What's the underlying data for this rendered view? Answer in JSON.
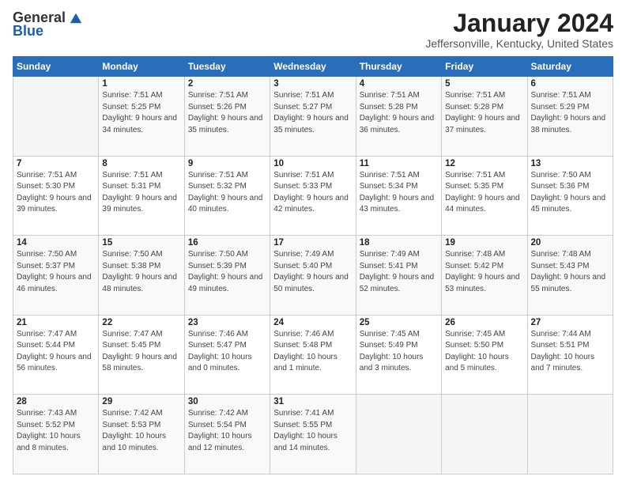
{
  "header": {
    "logo_general": "General",
    "logo_blue": "Blue",
    "month_title": "January 2024",
    "location": "Jeffersonville, Kentucky, United States"
  },
  "calendar": {
    "days_of_week": [
      "Sunday",
      "Monday",
      "Tuesday",
      "Wednesday",
      "Thursday",
      "Friday",
      "Saturday"
    ],
    "weeks": [
      [
        {
          "day": "",
          "sunrise": "",
          "sunset": "",
          "daylight": ""
        },
        {
          "day": "1",
          "sunrise": "Sunrise: 7:51 AM",
          "sunset": "Sunset: 5:25 PM",
          "daylight": "Daylight: 9 hours and 34 minutes."
        },
        {
          "day": "2",
          "sunrise": "Sunrise: 7:51 AM",
          "sunset": "Sunset: 5:26 PM",
          "daylight": "Daylight: 9 hours and 35 minutes."
        },
        {
          "day": "3",
          "sunrise": "Sunrise: 7:51 AM",
          "sunset": "Sunset: 5:27 PM",
          "daylight": "Daylight: 9 hours and 35 minutes."
        },
        {
          "day": "4",
          "sunrise": "Sunrise: 7:51 AM",
          "sunset": "Sunset: 5:28 PM",
          "daylight": "Daylight: 9 hours and 36 minutes."
        },
        {
          "day": "5",
          "sunrise": "Sunrise: 7:51 AM",
          "sunset": "Sunset: 5:28 PM",
          "daylight": "Daylight: 9 hours and 37 minutes."
        },
        {
          "day": "6",
          "sunrise": "Sunrise: 7:51 AM",
          "sunset": "Sunset: 5:29 PM",
          "daylight": "Daylight: 9 hours and 38 minutes."
        }
      ],
      [
        {
          "day": "7",
          "sunrise": "Sunrise: 7:51 AM",
          "sunset": "Sunset: 5:30 PM",
          "daylight": "Daylight: 9 hours and 39 minutes."
        },
        {
          "day": "8",
          "sunrise": "Sunrise: 7:51 AM",
          "sunset": "Sunset: 5:31 PM",
          "daylight": "Daylight: 9 hours and 39 minutes."
        },
        {
          "day": "9",
          "sunrise": "Sunrise: 7:51 AM",
          "sunset": "Sunset: 5:32 PM",
          "daylight": "Daylight: 9 hours and 40 minutes."
        },
        {
          "day": "10",
          "sunrise": "Sunrise: 7:51 AM",
          "sunset": "Sunset: 5:33 PM",
          "daylight": "Daylight: 9 hours and 42 minutes."
        },
        {
          "day": "11",
          "sunrise": "Sunrise: 7:51 AM",
          "sunset": "Sunset: 5:34 PM",
          "daylight": "Daylight: 9 hours and 43 minutes."
        },
        {
          "day": "12",
          "sunrise": "Sunrise: 7:51 AM",
          "sunset": "Sunset: 5:35 PM",
          "daylight": "Daylight: 9 hours and 44 minutes."
        },
        {
          "day": "13",
          "sunrise": "Sunrise: 7:50 AM",
          "sunset": "Sunset: 5:36 PM",
          "daylight": "Daylight: 9 hours and 45 minutes."
        }
      ],
      [
        {
          "day": "14",
          "sunrise": "Sunrise: 7:50 AM",
          "sunset": "Sunset: 5:37 PM",
          "daylight": "Daylight: 9 hours and 46 minutes."
        },
        {
          "day": "15",
          "sunrise": "Sunrise: 7:50 AM",
          "sunset": "Sunset: 5:38 PM",
          "daylight": "Daylight: 9 hours and 48 minutes."
        },
        {
          "day": "16",
          "sunrise": "Sunrise: 7:50 AM",
          "sunset": "Sunset: 5:39 PM",
          "daylight": "Daylight: 9 hours and 49 minutes."
        },
        {
          "day": "17",
          "sunrise": "Sunrise: 7:49 AM",
          "sunset": "Sunset: 5:40 PM",
          "daylight": "Daylight: 9 hours and 50 minutes."
        },
        {
          "day": "18",
          "sunrise": "Sunrise: 7:49 AM",
          "sunset": "Sunset: 5:41 PM",
          "daylight": "Daylight: 9 hours and 52 minutes."
        },
        {
          "day": "19",
          "sunrise": "Sunrise: 7:48 AM",
          "sunset": "Sunset: 5:42 PM",
          "daylight": "Daylight: 9 hours and 53 minutes."
        },
        {
          "day": "20",
          "sunrise": "Sunrise: 7:48 AM",
          "sunset": "Sunset: 5:43 PM",
          "daylight": "Daylight: 9 hours and 55 minutes."
        }
      ],
      [
        {
          "day": "21",
          "sunrise": "Sunrise: 7:47 AM",
          "sunset": "Sunset: 5:44 PM",
          "daylight": "Daylight: 9 hours and 56 minutes."
        },
        {
          "day": "22",
          "sunrise": "Sunrise: 7:47 AM",
          "sunset": "Sunset: 5:45 PM",
          "daylight": "Daylight: 9 hours and 58 minutes."
        },
        {
          "day": "23",
          "sunrise": "Sunrise: 7:46 AM",
          "sunset": "Sunset: 5:47 PM",
          "daylight": "Daylight: 10 hours and 0 minutes."
        },
        {
          "day": "24",
          "sunrise": "Sunrise: 7:46 AM",
          "sunset": "Sunset: 5:48 PM",
          "daylight": "Daylight: 10 hours and 1 minute."
        },
        {
          "day": "25",
          "sunrise": "Sunrise: 7:45 AM",
          "sunset": "Sunset: 5:49 PM",
          "daylight": "Daylight: 10 hours and 3 minutes."
        },
        {
          "day": "26",
          "sunrise": "Sunrise: 7:45 AM",
          "sunset": "Sunset: 5:50 PM",
          "daylight": "Daylight: 10 hours and 5 minutes."
        },
        {
          "day": "27",
          "sunrise": "Sunrise: 7:44 AM",
          "sunset": "Sunset: 5:51 PM",
          "daylight": "Daylight: 10 hours and 7 minutes."
        }
      ],
      [
        {
          "day": "28",
          "sunrise": "Sunrise: 7:43 AM",
          "sunset": "Sunset: 5:52 PM",
          "daylight": "Daylight: 10 hours and 8 minutes."
        },
        {
          "day": "29",
          "sunrise": "Sunrise: 7:42 AM",
          "sunset": "Sunset: 5:53 PM",
          "daylight": "Daylight: 10 hours and 10 minutes."
        },
        {
          "day": "30",
          "sunrise": "Sunrise: 7:42 AM",
          "sunset": "Sunset: 5:54 PM",
          "daylight": "Daylight: 10 hours and 12 minutes."
        },
        {
          "day": "31",
          "sunrise": "Sunrise: 7:41 AM",
          "sunset": "Sunset: 5:55 PM",
          "daylight": "Daylight: 10 hours and 14 minutes."
        },
        {
          "day": "",
          "sunrise": "",
          "sunset": "",
          "daylight": ""
        },
        {
          "day": "",
          "sunrise": "",
          "sunset": "",
          "daylight": ""
        },
        {
          "day": "",
          "sunrise": "",
          "sunset": "",
          "daylight": ""
        }
      ]
    ]
  }
}
